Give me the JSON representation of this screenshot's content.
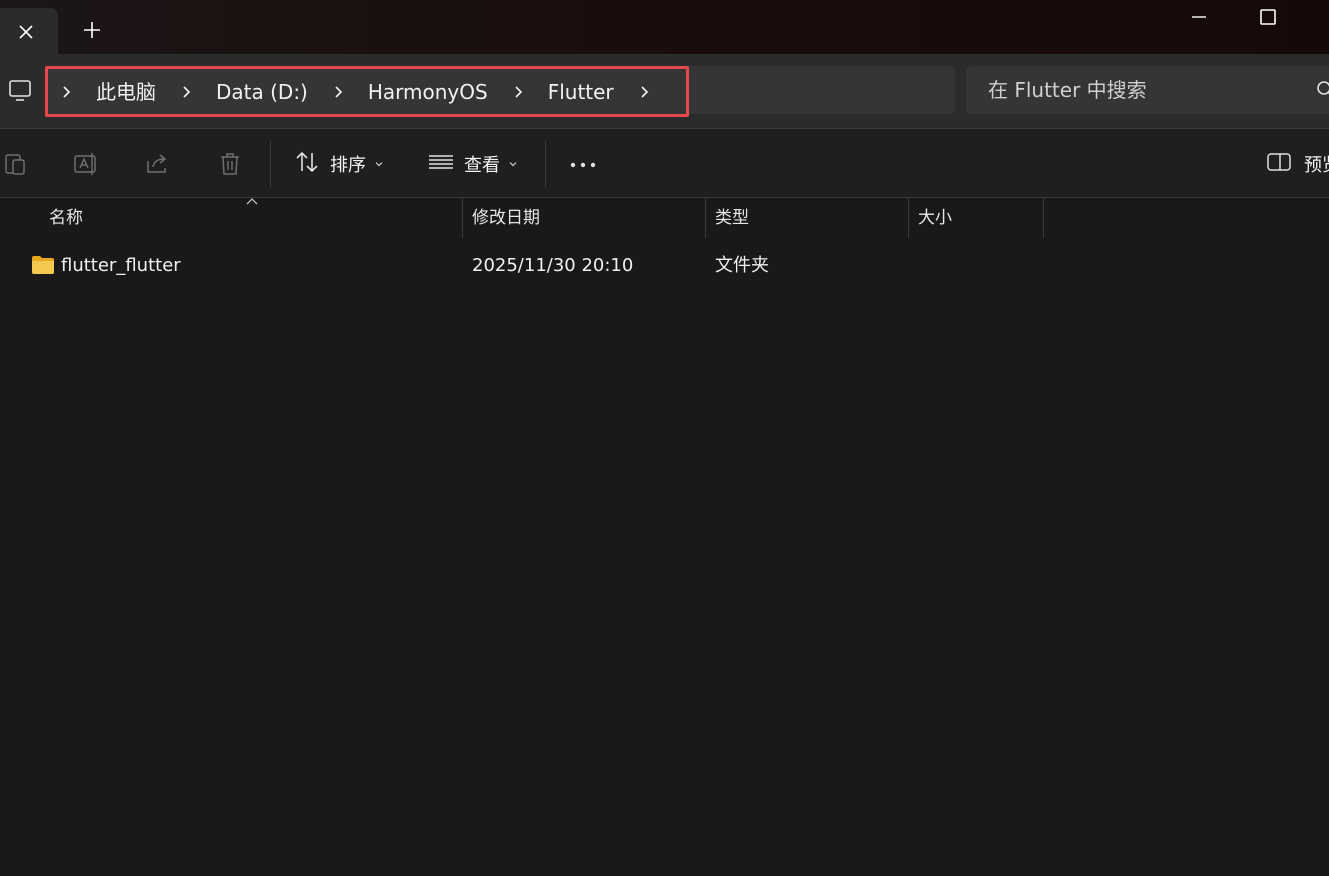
{
  "titlebar": {
    "tab_close_icon": "close-icon",
    "new_tab_icon": "plus-icon",
    "minimize_icon": "minimize-icon",
    "maximize_icon": "maximize-icon"
  },
  "address": {
    "root_icon": "this-pc-icon",
    "breadcrumbs": [
      "此电脑",
      "Data (D:)",
      "HarmonyOS",
      "Flutter"
    ],
    "highlight_color": "#e5484d"
  },
  "search": {
    "placeholder": "在 Flutter 中搜索",
    "icon": "search-icon"
  },
  "toolbar": {
    "paste_icon": "paste-icon",
    "rename_icon": "rename-icon",
    "share_icon": "share-icon",
    "delete_icon": "trash-icon",
    "sort_label": "排序",
    "view_label": "查看",
    "more_icon": "more-icon",
    "preview_label": "预览"
  },
  "list": {
    "columns": [
      "名称",
      "修改日期",
      "类型",
      "大小"
    ],
    "rows": [
      {
        "name": "flutter_flutter",
        "modified": "2025/11/30 20:10",
        "type": "文件夹",
        "size": ""
      }
    ]
  },
  "colors": {
    "background": "#191919",
    "folder": "#f2c14e"
  }
}
